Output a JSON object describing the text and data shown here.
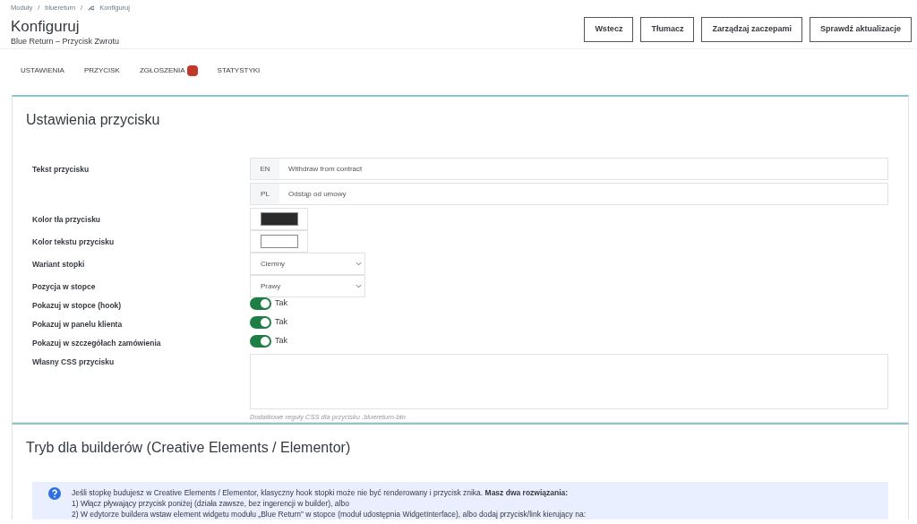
{
  "breadcrumb_separator": "/",
  "breadcrumb": [
    {
      "label": "Moduły",
      "icon": false
    },
    {
      "label": "bluereturn",
      "icon": false
    },
    {
      "label": "Konfiguruj",
      "icon": true
    }
  ],
  "title": "Konfiguruj",
  "subtitle": "Blue Return – Przycisk Zwrotu",
  "buttons": [
    "Wstecz",
    "Tłumacz",
    "Zarządzaj zaczepami",
    "Sprawdź aktualizacje"
  ],
  "tabs": [
    {
      "label": "USTAWIENIA",
      "badge": false
    },
    {
      "label": "PRZYCISK",
      "badge": false
    },
    {
      "label": "ZGŁOSZENIA",
      "badge": true
    },
    {
      "label": "STATYSTYKI",
      "badge": false
    }
  ],
  "sections": [
    {
      "title": "Ustawienia przycisku",
      "fields": [
        {
          "kind": "translated",
          "label": "Tekst przycisku",
          "langs": [
            {
              "code": "EN",
              "value": "Withdraw from contract"
            },
            {
              "code": "PL",
              "value": "Odstąp od umowy"
            }
          ]
        },
        {
          "kind": "color",
          "label": "Kolor tła przycisku",
          "color": "#2b2b2b"
        },
        {
          "kind": "color",
          "label": "Kolor tekstu przycisku",
          "color": "#ffffff"
        },
        {
          "kind": "select",
          "label": "Wariant stopki",
          "value": "Ciemny"
        },
        {
          "kind": "select",
          "label": "Pozycja w stopce",
          "value": "Prawy"
        },
        {
          "kind": "toggle",
          "label": "Pokazuj w stopce (hook)",
          "on": true,
          "text": "Tak"
        },
        {
          "kind": "toggle",
          "label": "Pokazuj w panelu klienta",
          "on": true,
          "text": "Tak"
        },
        {
          "kind": "toggle",
          "label": "Pokazuj w szczegółach zamówienia",
          "on": true,
          "text": "Tak"
        },
        {
          "kind": "textarea",
          "label": "Własny CSS przycisku",
          "help": "Dodatkowe reguły CSS dla przycisku .bluereturn-btn"
        }
      ]
    },
    {
      "title": "Tryb dla builderów (Creative Elements / Elementor)",
      "info": [
        "Jeśli stopkę budujesz w Creative Elements / Elementor, klasyczny hook stopki może nie być renderowany i przycisk znika. **Masz dwa rozwiązania:**",
        "1) Włącz pływający przycisk poniżej (działa zawsze, bez ingerencji w builder), albo",
        "2) W edytorze buildera wstaw element widgetu modułu „Blue Return” w stopce (moduł udostępnia WidgetInterface), albo dodaj przycisk/link kierujący na:"
      ]
    }
  ]
}
